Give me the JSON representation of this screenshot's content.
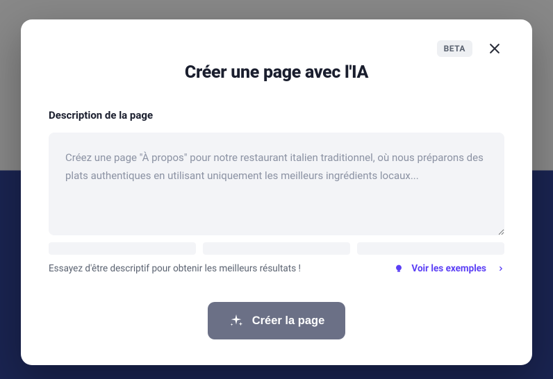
{
  "modal": {
    "beta_badge": "BETA",
    "title": "Créer une page avec l'IA",
    "section_label": "Description de la page",
    "textarea_placeholder": "Créez une page \"À propos\" pour notre restaurant italien traditionnel, où nous préparons des plats authentiques en utilisant uniquement les meilleurs ingrédients locaux...",
    "textarea_value": "",
    "hint_text": "Essayez d'être descriptif pour obtenir les meilleurs résultats !",
    "examples_link": "Voir les exemples",
    "create_button": "Créer la page"
  }
}
